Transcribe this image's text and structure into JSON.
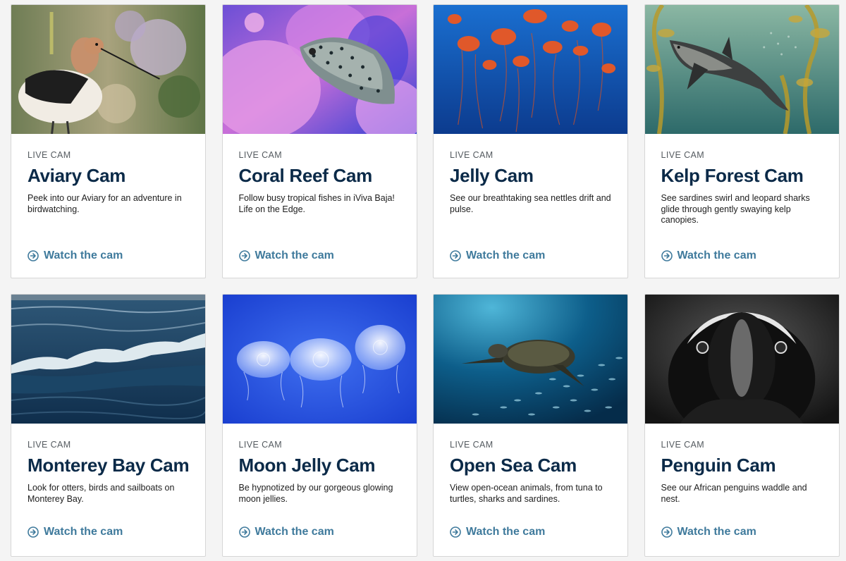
{
  "cams": [
    {
      "kicker": "LIVE CAM",
      "title": "Aviary Cam",
      "description": "Peek into our Aviary for an adventure in birdwatching.",
      "cta": "Watch the cam",
      "image": "avocet-bird"
    },
    {
      "kicker": "LIVE CAM",
      "title": "Coral Reef Cam",
      "description": "Follow busy tropical fishes in iViva Baja! Life on the Edge.",
      "cta": "Watch the cam",
      "image": "boxfish-coral"
    },
    {
      "kicker": "LIVE CAM",
      "title": "Jelly Cam",
      "description": "See our breathtaking sea nettles drift and pulse.",
      "cta": "Watch the cam",
      "image": "sea-nettles"
    },
    {
      "kicker": "LIVE CAM",
      "title": "Kelp Forest Cam",
      "description": "See sardines swirl and leopard sharks glide through gently swaying kelp canopies.",
      "cta": "Watch the cam",
      "image": "leopard-shark-kelp"
    },
    {
      "kicker": "LIVE CAM",
      "title": "Monterey Bay Cam",
      "description": "Look for otters, birds and sailboats on Monterey Bay.",
      "cta": "Watch the cam",
      "image": "ocean-waves"
    },
    {
      "kicker": "LIVE CAM",
      "title": "Moon Jelly Cam",
      "description": "Be hypnotized by our gorgeous glowing moon jellies.",
      "cta": "Watch the cam",
      "image": "moon-jellies"
    },
    {
      "kicker": "LIVE CAM",
      "title": "Open Sea Cam",
      "description": "View open-ocean animals, from tuna to turtles, sharks and sardines.",
      "cta": "Watch the cam",
      "image": "sea-turtle"
    },
    {
      "kicker": "LIVE CAM",
      "title": "Penguin Cam",
      "description": "See our African penguins waddle and nest.",
      "cta": "Watch the cam",
      "image": "african-penguin"
    }
  ],
  "colors": {
    "title": "#0b2a48",
    "link": "#3f7a9c",
    "border": "#d6d6d6",
    "background": "#f4f4f4"
  }
}
